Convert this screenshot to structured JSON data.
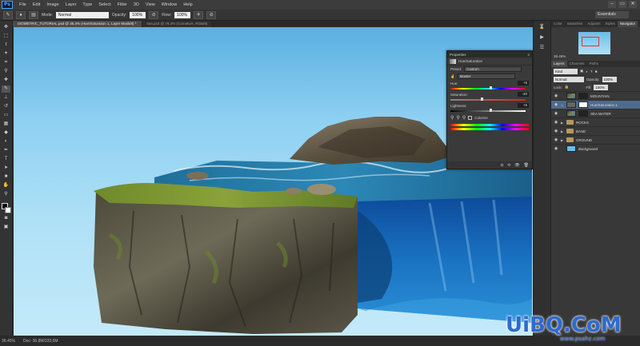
{
  "menubar": {
    "logo": "Ps",
    "items": [
      "File",
      "Edit",
      "Image",
      "Layer",
      "Type",
      "Select",
      "Filter",
      "3D",
      "View",
      "Window",
      "Help"
    ],
    "window_buttons": [
      "–",
      "▭",
      "✕"
    ]
  },
  "options": {
    "mode_label": "Mode:",
    "mode_value": "Normal",
    "opacity_label": "Opacity:",
    "opacity_value": "100%",
    "flow_label": "Flow:",
    "flow_value": "100%",
    "workspace": "Essentials"
  },
  "doc_tabs": [
    "ISOMETRIC_TUTORIAL.psd @ 36,4% (Hue/Saturation 1, Layer Mask/8) *",
    "sea.psd @ 79,4% (Cornelo/A, RGB/8)"
  ],
  "status": {
    "zoom": "36.45%",
    "doc": "Doc: 36,8M/333,5M"
  },
  "right_panel": {
    "top_tabs": [
      "Color",
      "Swatches",
      "Adjustm",
      "Styles",
      "Navigator"
    ],
    "active_top": "Navigator",
    "nav_zoom": "36.45%",
    "layer_tabs": [
      "Layers",
      "Channels",
      "Paths"
    ],
    "kind_label": "Kind",
    "blend_mode": "Normal",
    "opacity_label": "Opacity:",
    "opacity_value": "100%",
    "lock_label": "Lock:",
    "fill_label": "Fill:",
    "fill_value": "100%",
    "layers": [
      {
        "name": "MOUNTAIN",
        "thumb": "img",
        "selected": false
      },
      {
        "name": "Hue/Saturation 1",
        "thumb": "white",
        "selected": true
      },
      {
        "name": "SEA WATER",
        "thumb": "dark",
        "selected": false
      },
      {
        "name": "ROCKS",
        "folder": true,
        "selected": false
      },
      {
        "name": "BASE",
        "folder": true,
        "selected": false
      },
      {
        "name": "GROUND",
        "folder": true,
        "selected": false
      },
      {
        "name": "Background",
        "thumb": "blue",
        "selected": false
      }
    ]
  },
  "properties": {
    "header": "Properties",
    "title": "Hue/Saturation",
    "preset_label": "Preset:",
    "preset_value": "Custom",
    "channel_value": "Master",
    "hue_label": "Hue:",
    "hue_value": "+5",
    "saturation_label": "Saturation:",
    "saturation_value": "-20",
    "lightness_label": "Lightness:",
    "lightness_value": "+5",
    "colorize_label": "Colorize",
    "footer_icons": [
      "◘",
      "⟲",
      "👁",
      "🗑"
    ]
  },
  "watermark": {
    "text": "UiBQ.CoM",
    "sub": "www.psahz.com"
  },
  "colors": {
    "accent": "#4aa3ff",
    "selected_layer": "#4f6b8c",
    "sky_top": "#5ab0e0",
    "sky_bottom": "#c4eafa"
  },
  "tools": [
    "move-tool",
    "marquee-tool",
    "lasso-tool",
    "quick-select-tool",
    "crop-tool",
    "eyedropper-tool",
    "healing-tool",
    "brush-tool",
    "stamp-tool",
    "history-brush-tool",
    "eraser-tool",
    "gradient-tool",
    "blur-tool",
    "dodge-tool",
    "pen-tool",
    "type-tool",
    "path-select-tool",
    "shape-tool",
    "hand-tool",
    "zoom-tool"
  ]
}
